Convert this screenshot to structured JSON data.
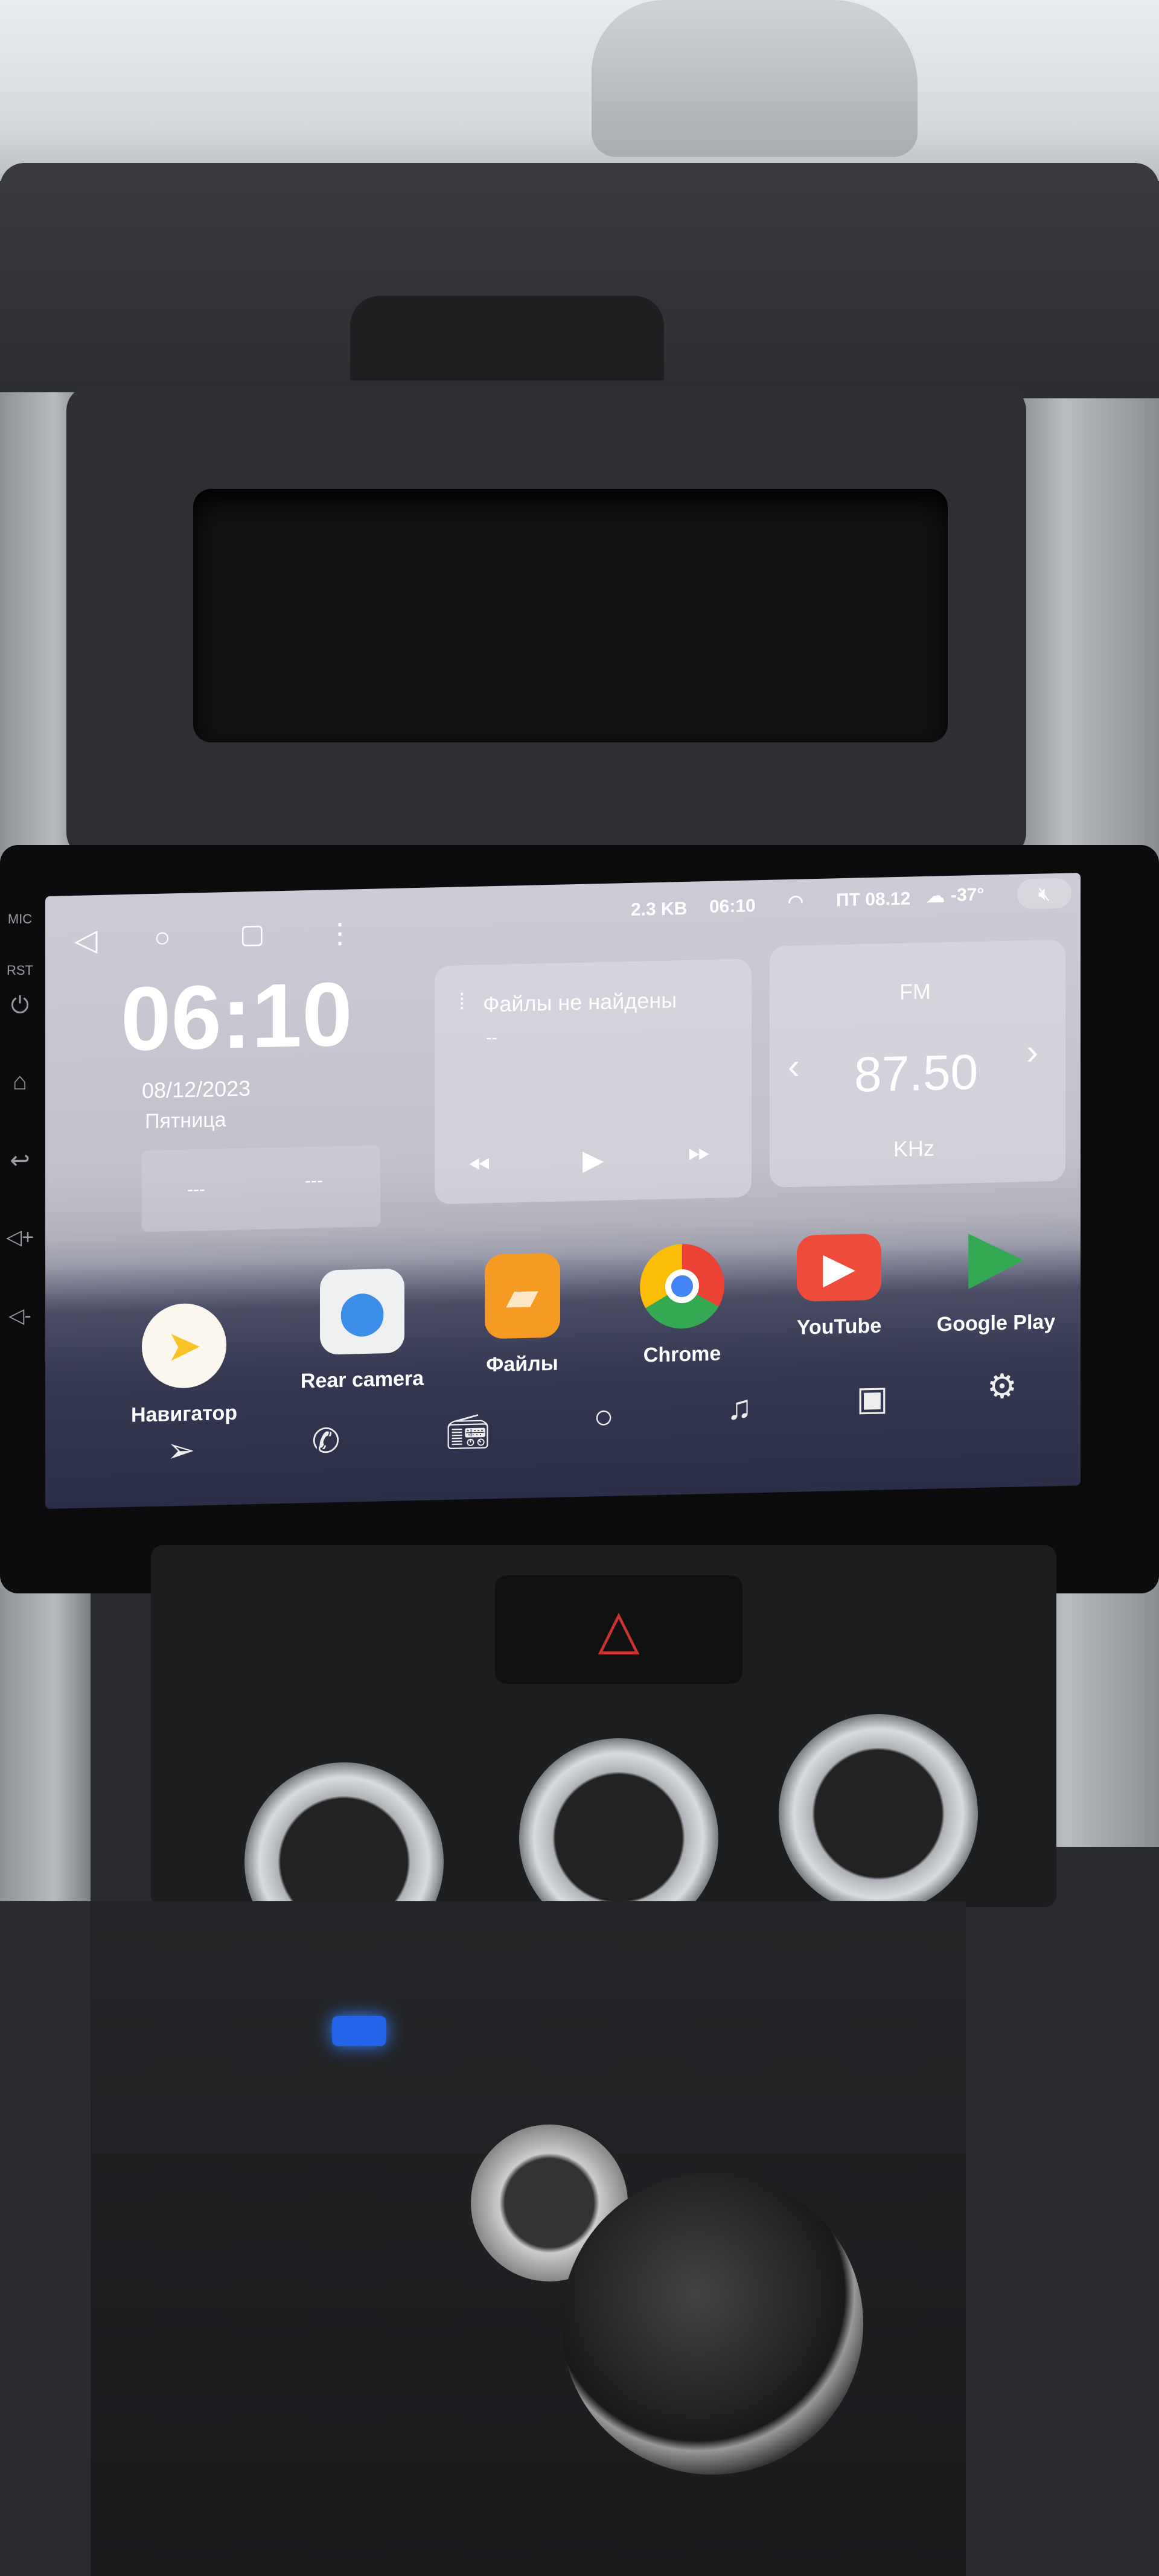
{
  "bezel": {
    "labels": [
      "MIC",
      "RST"
    ]
  },
  "status_bar": {
    "data_rate": "2.3 KB",
    "time": "06:10",
    "date": "ПТ 08.12",
    "temperature": "-37°"
  },
  "clock_widget": {
    "time": "06:10",
    "date": "08/12/2023",
    "weekday": "Пятница",
    "slot1": "---",
    "slot2": "---"
  },
  "music_widget": {
    "title": "Файлы не найдены",
    "subtitle": "--"
  },
  "radio_widget": {
    "band": "FM",
    "frequency": "87.50",
    "unit": "KHz"
  },
  "apps": [
    {
      "label": "Навигатор",
      "icon": "navigator-icon",
      "color": "#f7c325"
    },
    {
      "label": "Rear camera",
      "icon": "rear-camera-icon",
      "color": "#3b8fe8"
    },
    {
      "label": "Файлы",
      "icon": "files-icon",
      "color": "#f59a23"
    },
    {
      "label": "Chrome",
      "icon": "chrome-icon",
      "color": "#4285f4"
    },
    {
      "label": "YouTube",
      "icon": "youtube-icon",
      "color": "#ef4b3a"
    },
    {
      "label": "Google Play",
      "icon": "google-play-icon",
      "color": "#34a853"
    }
  ],
  "dock": [
    "navigation-icon",
    "phone-icon",
    "radio-icon",
    "home-circle-icon",
    "music-icon",
    "video-icon",
    "settings-icon"
  ],
  "hazard": {
    "color": "#cc3333"
  }
}
